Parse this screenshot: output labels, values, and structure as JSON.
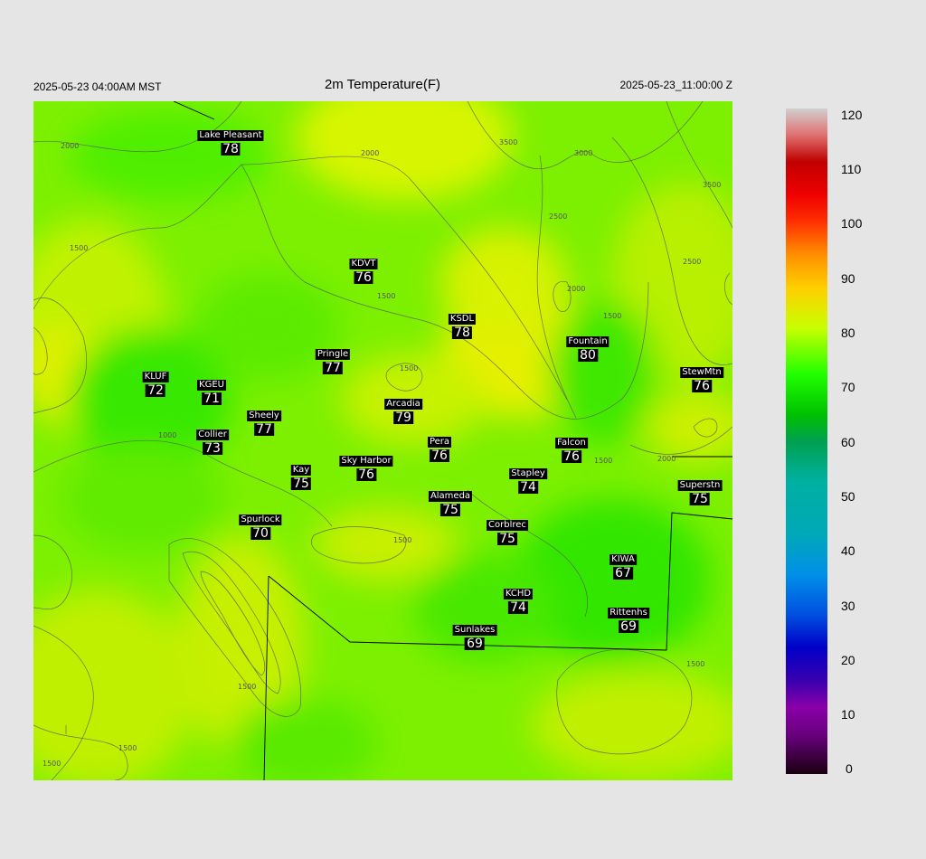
{
  "header": {
    "local_time": "2025-05-23 04:00AM MST",
    "title": "2m Temperature(F)",
    "utc_time": "2025-05-23_11:00:00 Z"
  },
  "map": {
    "field": "2m Temperature(F)",
    "contour_labels": [
      "2000",
      "3500",
      "3000",
      "3500",
      "2000",
      "2500",
      "2000",
      "2500",
      "1500",
      "1500",
      "1500",
      "2000",
      "1500",
      "1000",
      "1500",
      "1500",
      "1500",
      "1500",
      "1500",
      "1500"
    ],
    "stations": [
      {
        "name": "Lake Pleasant",
        "value": "78"
      },
      {
        "name": "KDVT",
        "value": "76"
      },
      {
        "name": "KSDL",
        "value": "78"
      },
      {
        "name": "Fountain",
        "value": "80"
      },
      {
        "name": "StewMtn",
        "value": "76"
      },
      {
        "name": "Pringle",
        "value": "77"
      },
      {
        "name": "KLUF",
        "value": "72"
      },
      {
        "name": "KGEU",
        "value": "71"
      },
      {
        "name": "Arcadia",
        "value": "79"
      },
      {
        "name": "Sheely",
        "value": "77"
      },
      {
        "name": "Collier",
        "value": "73"
      },
      {
        "name": "Pera",
        "value": "76"
      },
      {
        "name": "Falcon",
        "value": "76"
      },
      {
        "name": "Sky Harbor",
        "value": "76"
      },
      {
        "name": "Kay",
        "value": "75"
      },
      {
        "name": "Stapley",
        "value": "74"
      },
      {
        "name": "Superstn",
        "value": "75"
      },
      {
        "name": "Alameda",
        "value": "75"
      },
      {
        "name": "Spurlock",
        "value": "70"
      },
      {
        "name": "Corblrec",
        "value": "75"
      },
      {
        "name": "KIWA",
        "value": "67"
      },
      {
        "name": "KCHD",
        "value": "74"
      },
      {
        "name": "Rittenhs",
        "value": "69"
      },
      {
        "name": "Sunlakes",
        "value": "69"
      }
    ]
  },
  "colorbar": {
    "ticks": [
      "120",
      "110",
      "100",
      "90",
      "80",
      "70",
      "60",
      "50",
      "40",
      "30",
      "20",
      "10",
      "0"
    ],
    "min": 0,
    "max": 120,
    "colors": [
      "#1a0010",
      "#6a0080",
      "#8a00a8",
      "#3a00b0",
      "#0000c8",
      "#0050e0",
      "#0090e8",
      "#00a8b8",
      "#00b0a0",
      "#00a050",
      "#00c000",
      "#20ff00",
      "#c8ff00",
      "#ffd000",
      "#ff9000",
      "#ff3000",
      "#f00000",
      "#c00000",
      "#e07070",
      "#d0d0d0"
    ]
  }
}
